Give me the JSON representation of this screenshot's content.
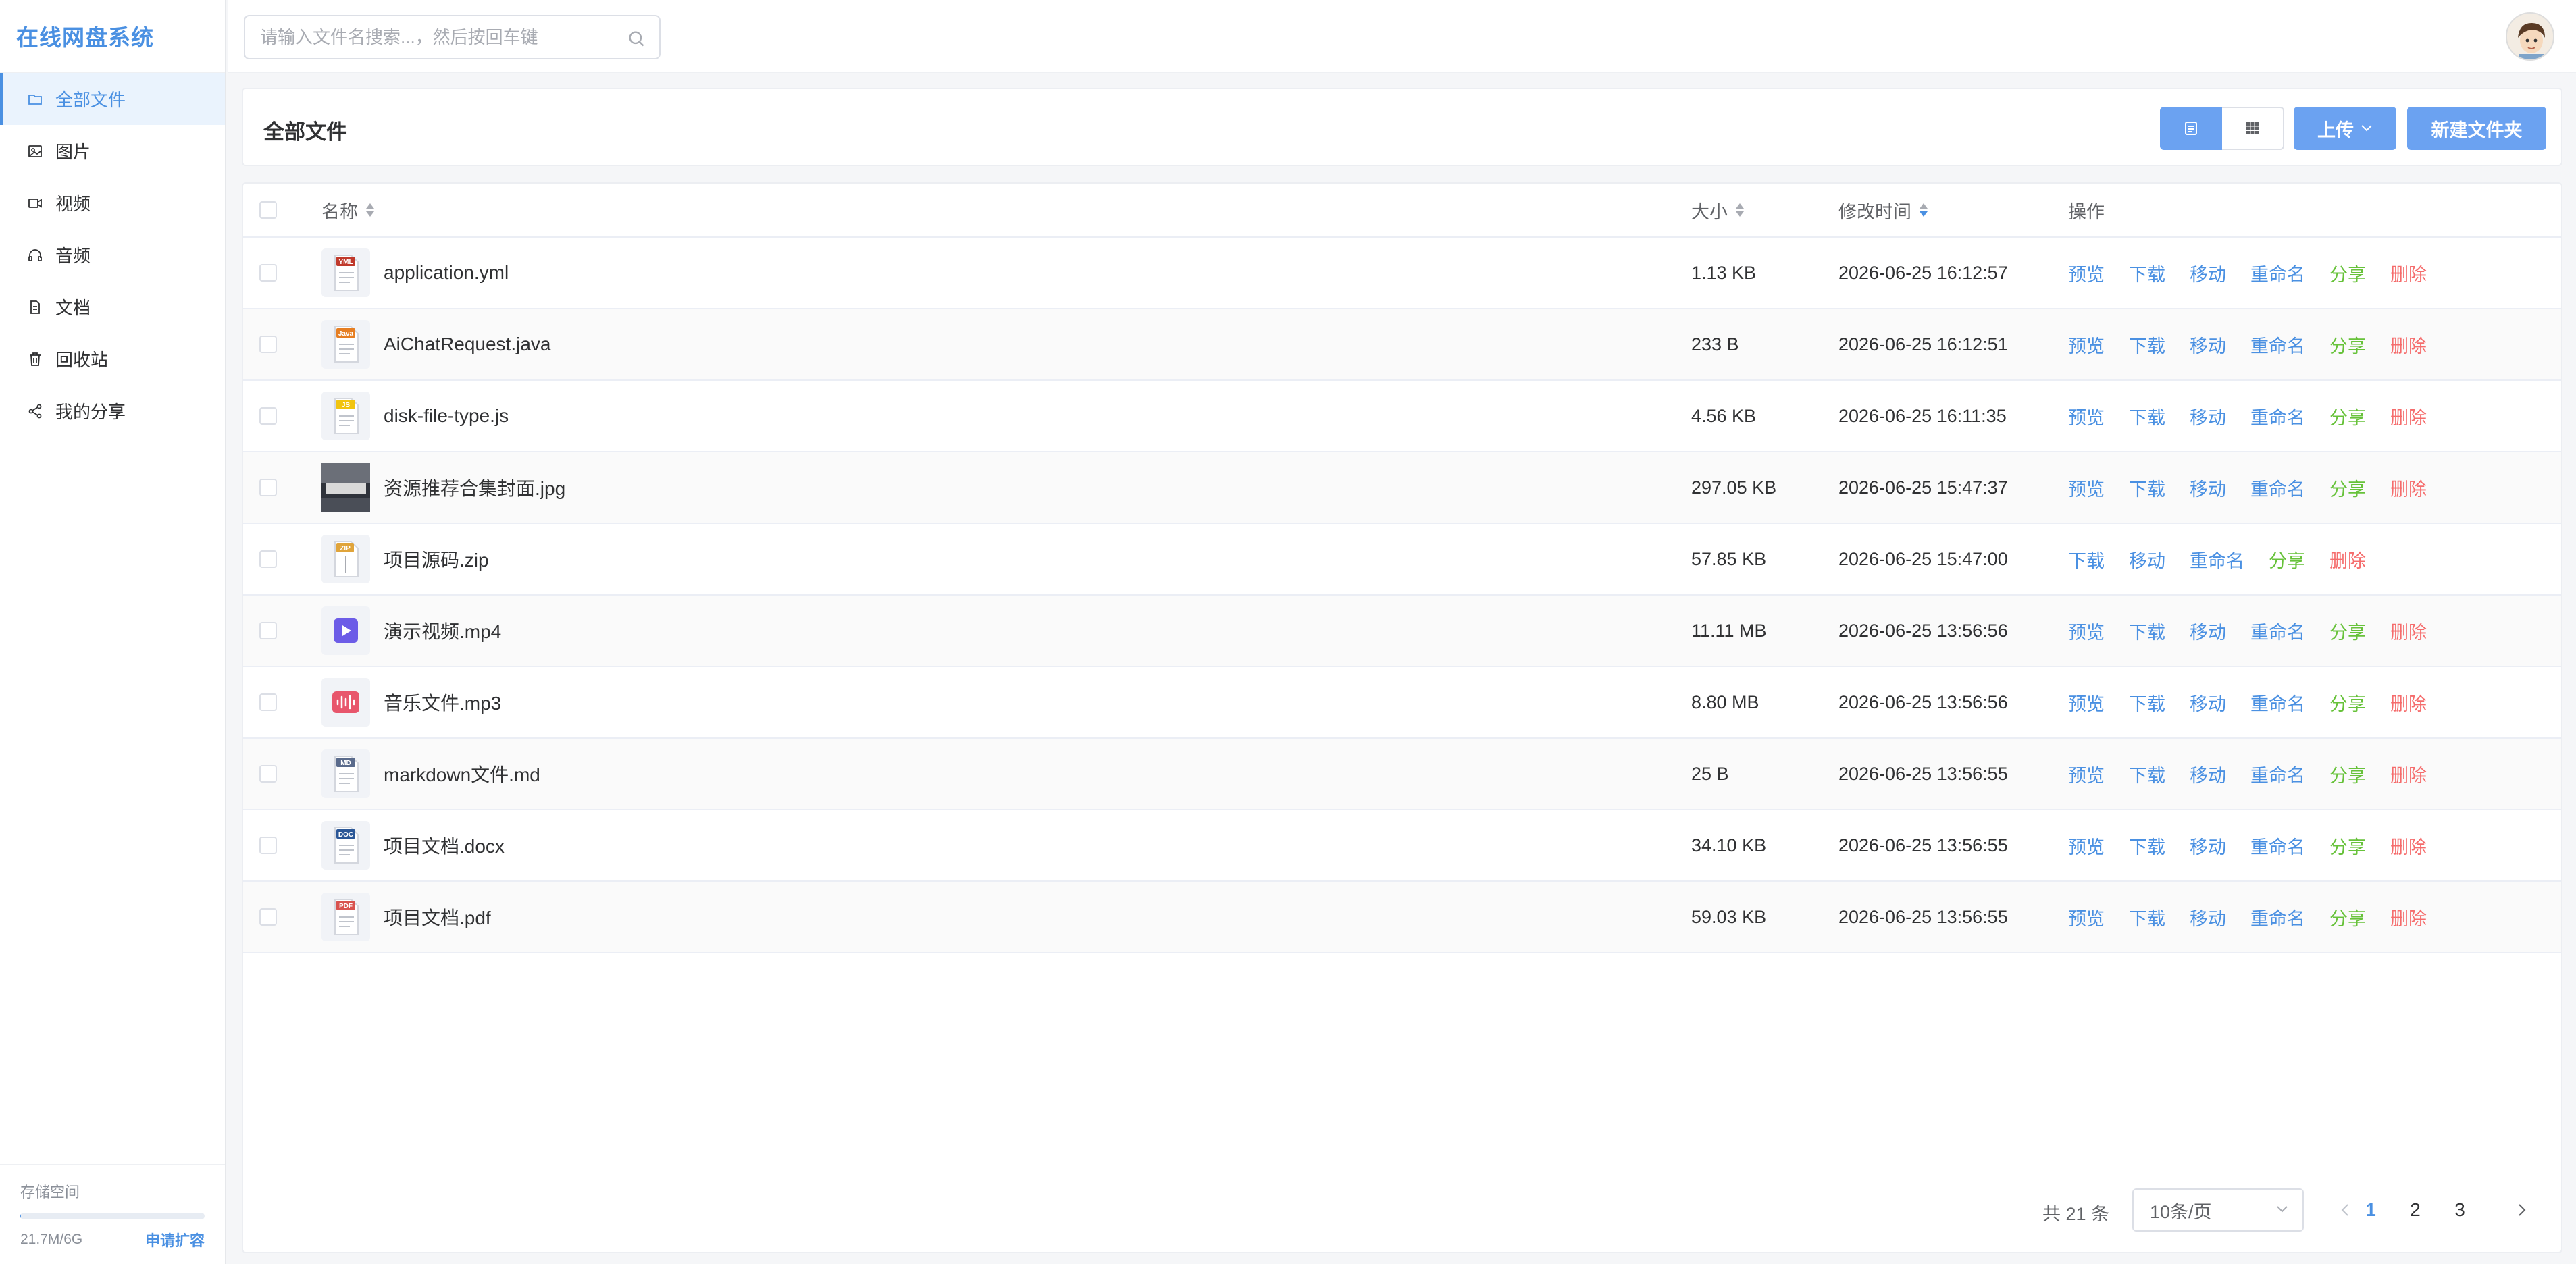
{
  "app": {
    "brand": "在线网盘系统"
  },
  "sidebar": {
    "items": [
      {
        "label": "全部文件",
        "icon": "folder-icon",
        "active": true
      },
      {
        "label": "图片",
        "icon": "image-icon"
      },
      {
        "label": "视频",
        "icon": "video-icon"
      },
      {
        "label": "音频",
        "icon": "headphones-icon"
      },
      {
        "label": "文档",
        "icon": "document-icon"
      },
      {
        "label": "回收站",
        "icon": "trash-icon"
      },
      {
        "label": "我的分享",
        "icon": "share-icon"
      }
    ],
    "storage": {
      "title": "存储空间",
      "used": "21.7M/6G",
      "apply": "申请扩容",
      "fraction": 0.0035
    }
  },
  "header": {
    "search_placeholder": "请输入文件名搜索...，然后按回车键"
  },
  "toolbar": {
    "title": "全部文件",
    "upload_label": "上传",
    "new_folder_label": "新建文件夹"
  },
  "table": {
    "columns": {
      "name": "名称",
      "size": "大小",
      "modified": "修改时间",
      "ops": "操作"
    },
    "ops_labels": {
      "preview": "预览",
      "download": "下载",
      "move": "移动",
      "rename": "重命名",
      "share": "分享",
      "delete": "删除"
    },
    "rows": [
      {
        "name": "application.yml",
        "size": "1.13 KB",
        "modified": "2026-06-25 16:12:57",
        "type": "YML",
        "color": "#c0392b",
        "preview": true
      },
      {
        "name": "AiChatRequest.java",
        "size": "233 B",
        "modified": "2026-06-25 16:12:51",
        "type": "Java",
        "color": "#e67e22",
        "preview": true
      },
      {
        "name": "disk-file-type.js",
        "size": "4.56 KB",
        "modified": "2026-06-25 16:11:35",
        "type": "JS",
        "color": "#f1c40f",
        "preview": true
      },
      {
        "name": "资源推荐合集封面.jpg",
        "size": "297.05 KB",
        "modified": "2026-06-25 15:47:37",
        "type": "image",
        "color": "#3b3f47",
        "preview": true
      },
      {
        "name": "项目源码.zip",
        "size": "57.85 KB",
        "modified": "2026-06-25 15:47:00",
        "type": "ZIP",
        "color": "#e0a43a",
        "preview": false
      },
      {
        "name": "演示视频.mp4",
        "size": "11.11 MB",
        "modified": "2026-06-25 13:56:56",
        "type": "video",
        "color": "#6c5ce7",
        "preview": true
      },
      {
        "name": "音乐文件.mp3",
        "size": "8.80 MB",
        "modified": "2026-06-25 13:56:56",
        "type": "audio",
        "color": "#e8566c",
        "preview": true
      },
      {
        "name": "markdown文件.md",
        "size": "25 B",
        "modified": "2026-06-25 13:56:55",
        "type": "MD",
        "color": "#5a6b8c",
        "preview": true
      },
      {
        "name": "项目文档.docx",
        "size": "34.10 KB",
        "modified": "2026-06-25 13:56:55",
        "type": "DOC",
        "color": "#2b5797",
        "preview": true
      },
      {
        "name": "项目文档.pdf",
        "size": "59.03 KB",
        "modified": "2026-06-25 13:56:55",
        "type": "PDF",
        "color": "#d9534f",
        "preview": true
      }
    ]
  },
  "pagination": {
    "total": "共 21 条",
    "page_size": "10条/页",
    "pages": [
      "1",
      "2",
      "3"
    ],
    "current": "1"
  },
  "colors": {
    "accent": "#4a90e2",
    "button": "#6ba2f1",
    "success": "#67c23a",
    "danger": "#f56c6c"
  }
}
